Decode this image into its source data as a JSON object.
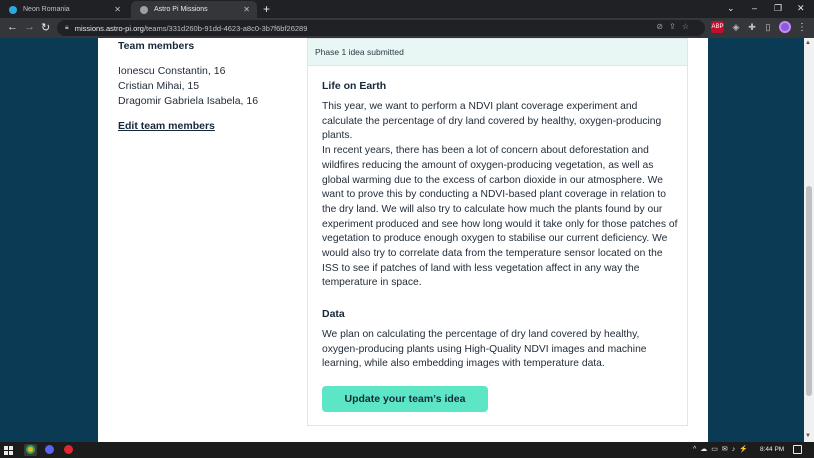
{
  "browser": {
    "tabs": [
      {
        "title": "Neon Romania",
        "active": false,
        "favicon_color": "#2ea9e0"
      },
      {
        "title": "Astro Pi Missions",
        "active": true,
        "favicon_color": "#9aa0a6"
      }
    ],
    "new_tab_symbol": "+",
    "window_controls": [
      "⌄",
      "–",
      "❐",
      "✕"
    ],
    "nav": {
      "back": "←",
      "forward": "→",
      "reload": "↻"
    },
    "url_host": "missions.astro-pi.org",
    "url_path": "/teams/331d260b-91dd-4623-a8c0-3b7f6bf26289",
    "omnibox_icons": [
      "eye-slash-icon",
      "share-icon",
      "star-icon"
    ],
    "extensions": [
      {
        "label": "ABP",
        "color": "#c70d2c",
        "name": "adblock-icon"
      },
      {
        "label": "◈",
        "color": "#5f6368",
        "name": "extension-diamond-icon"
      },
      {
        "label": "✚",
        "color": "#5f6368",
        "name": "puzzle-icon"
      },
      {
        "label": "▯",
        "color": "#5f6368",
        "name": "sidepanel-icon"
      },
      {
        "label": "",
        "color": "#8e5bd9",
        "name": "profile-avatar"
      },
      {
        "label": "⋮",
        "color": "#35363a",
        "name": "menu-icon"
      }
    ]
  },
  "team": {
    "heading": "Team members",
    "members": [
      "Ionescu Constantin, 16",
      "Cristian Mihai, 15",
      "Dragomir Gabriela Isabela, 16"
    ],
    "edit_link": "Edit team members"
  },
  "idea": {
    "status": "Phase 1 idea submitted",
    "section1_title": "Life on Earth",
    "section1_text": "This year, we want to perform a NDVI plant coverage experiment and calculate the percentage of dry land covered by healthy, oxygen-producing plants.\nIn recent years, there has been a lot of concern about deforestation and wildfires reducing the amount of oxygen-producing vegetation, as well as global warming due to the excess of carbon dioxide in our atmosphere. We want to prove this by conducting a NDVI-based plant coverage in relation to the dry land. We will also try to calculate how much the plants found by our experiment produced and see how long would it take only for those patches of vegetation to produce enough oxygen to stabilise our current deficiency. We would also try to correlate data from the temperature sensor located on the ISS to see if patches of land with less vegetation affect in any way the temperature in space.",
    "section2_title": "Data",
    "section2_text": "We plan on calculating the percentage of dry land covered by healthy, oxygen-producing plants using High-Quality NDVI images and machine learning, while also embedding images with temperature data.",
    "update_button": "Update your team’s idea"
  },
  "taskbar": {
    "apps": [
      {
        "name": "chrome-taskbar-icon",
        "color": "#e8b324"
      },
      {
        "name": "discord-taskbar-icon",
        "color": "#5865f2"
      },
      {
        "name": "opera-taskbar-icon",
        "color": "#e0262e"
      }
    ],
    "tray_icons": [
      "^",
      "☁",
      "▭",
      "✉",
      "🔊",
      "⚡"
    ],
    "time": "8:44 PM"
  },
  "colors": {
    "page_background": "#0b3a55",
    "status_bar": "#e8f7f3",
    "button": "#5de6c6",
    "heading_text": "#16283a"
  }
}
